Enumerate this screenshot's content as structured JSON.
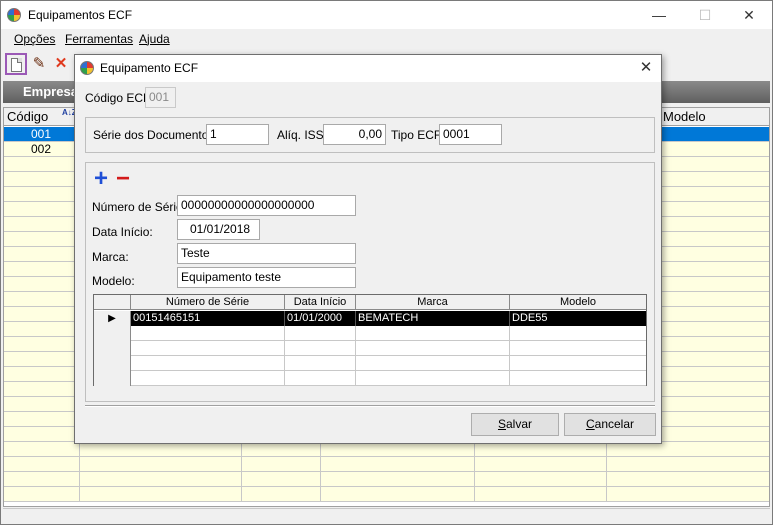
{
  "window": {
    "title": "Equipamentos ECF",
    "controls": {
      "minimize": "—",
      "maximize": "☐",
      "close": "✕"
    }
  },
  "menu": [
    {
      "first": "O",
      "rest": "pções"
    },
    {
      "first": "F",
      "rest": "erramentas"
    },
    {
      "first": "A",
      "rest": "juda"
    }
  ],
  "toolbar": {
    "icons": [
      "new-document-icon",
      "edit-pencil-icon",
      "delete-x-icon"
    ],
    "delete_glyph": "✕",
    "edit_glyph": "✎"
  },
  "group_band": {
    "label": "Empresa"
  },
  "main_grid": {
    "columns": {
      "codigo": "Código",
      "sort_glyph": "A↓Z",
      "modelo": "Modelo"
    },
    "rows": [
      {
        "codigo": "001",
        "selected": true
      },
      {
        "codigo": "002",
        "selected": false
      }
    ]
  },
  "dialog": {
    "title": "Equipamento ECF",
    "close": "✕",
    "codigo_ecf": {
      "label": "Código ECF:",
      "value": "001"
    },
    "serie_documentos": {
      "label": "Série dos Documentos:",
      "value": "1"
    },
    "aliq_iss": {
      "label": "Alíq. ISS:",
      "value": "0,00"
    },
    "tipo_ecf": {
      "label": "Tipo ECF:",
      "value": "0001"
    },
    "add_glyph": "+",
    "remove_glyph": "−",
    "numero_serie": {
      "label": "Número de Série:",
      "value": "00000000000000000000"
    },
    "data_inicio": {
      "label": "Data Início:",
      "value": "01/01/2018"
    },
    "marca": {
      "label": "Marca:",
      "value": "Teste"
    },
    "modelo": {
      "label": "Modelo:",
      "value": "Equipamento teste"
    },
    "grid": {
      "headers": [
        "Número de Série",
        "Data Início",
        "Marca",
        "Modelo"
      ],
      "indicator": "▶",
      "rows": [
        [
          "00151465151",
          "01/01/2000",
          "BEMATECH",
          "DDE55"
        ]
      ]
    },
    "buttons": {
      "save": {
        "first": "S",
        "rest": "alvar"
      },
      "cancel": {
        "first": "C",
        "rest": "ancelar"
      }
    }
  }
}
